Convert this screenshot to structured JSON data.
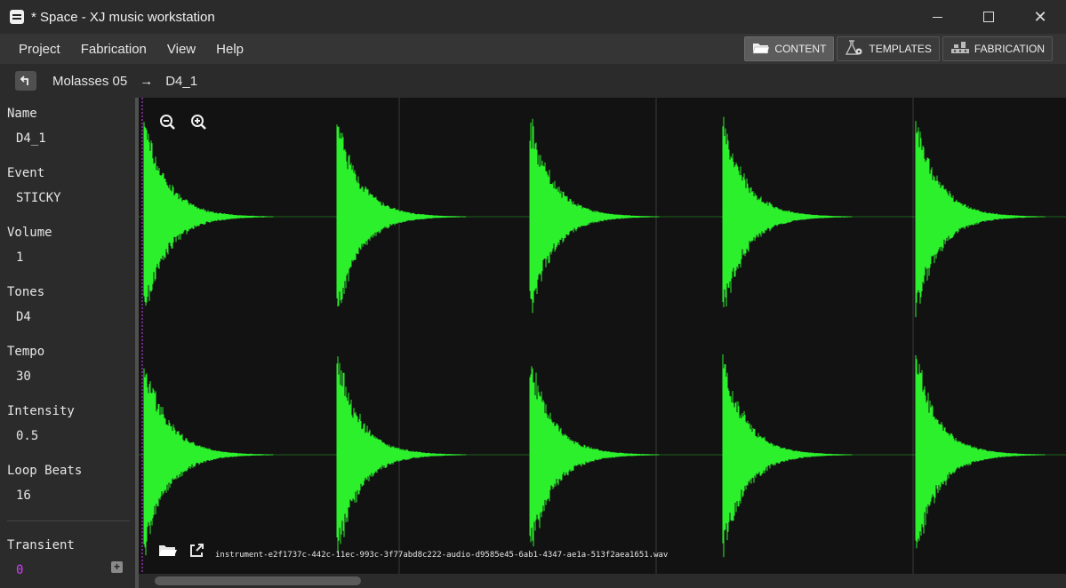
{
  "window": {
    "title": "* Space - XJ music workstation"
  },
  "menu": {
    "items": [
      "Project",
      "Fabrication",
      "View",
      "Help"
    ]
  },
  "modes": [
    {
      "label": "CONTENT",
      "icon": "folder-icon",
      "active": true
    },
    {
      "label": "TEMPLATES",
      "icon": "flask-gear-icon",
      "active": false
    },
    {
      "label": "FABRICATION",
      "icon": "fabrication-icon",
      "active": false
    }
  ],
  "breadcrumb": {
    "parent": "Molasses 05",
    "arrow": "→",
    "current": "D4_1"
  },
  "fields": [
    {
      "label": "Name",
      "value": "D4_1"
    },
    {
      "label": "Event",
      "value": "STICKY"
    },
    {
      "label": "Volume",
      "value": "1"
    },
    {
      "label": "Tones",
      "value": "D4"
    },
    {
      "label": "Tempo",
      "value": "30"
    },
    {
      "label": "Intensity",
      "value": "0.5"
    },
    {
      "label": "Loop Beats",
      "value": "16"
    }
  ],
  "transient": {
    "label": "Transient",
    "value": "0",
    "add_label": "+"
  },
  "waveform": {
    "file_name": "instrument-e2f1737c-442c-11ec-993c-3f77abd8c222-audio-d9585e45-6ab1-4347-ae1a-513f2aea1651.wav",
    "channels": 2,
    "hits": 5,
    "color": "#2cf02c",
    "playhead_color": "#d63cff"
  },
  "colors": {
    "background": "#1e1e1e",
    "panel": "#2b2b2b",
    "accent_active": "#5c5c5c"
  }
}
